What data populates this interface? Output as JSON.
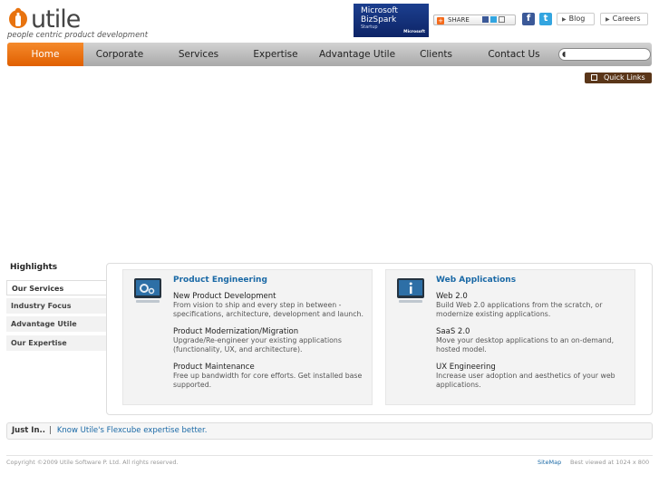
{
  "header": {
    "logo_text": "utile",
    "tagline": "people centric product development",
    "bizspark": {
      "line1": "Microsoft",
      "line2": "BizSpark",
      "line3": "Startup",
      "brand": "Microsoft"
    },
    "share_label": "SHARE",
    "blog_label": "Blog",
    "careers_label": "Careers"
  },
  "nav": {
    "items": [
      "Home",
      "Corporate",
      "Services",
      "Expertise",
      "Advantage Utile",
      "Clients",
      "Contact Us"
    ],
    "active": "Home",
    "search_placeholder": ""
  },
  "quick_links_label": "Quick Links",
  "highlights": {
    "title": "Highlights",
    "tabs": [
      "Our Services",
      "Industry Focus",
      "Advantage Utile",
      "Our Expertise"
    ],
    "cards": [
      {
        "title": "Product Engineering",
        "items": [
          {
            "title": "New Product Development",
            "desc": "From vision to ship and every step in between - specifications, architecture, development and launch."
          },
          {
            "title": "Product Modernization/Migration",
            "desc": "Upgrade/Re-engineer your existing applications (functionality, UX, and architecture)."
          },
          {
            "title": "Product Maintenance",
            "desc": "Free up bandwidth for core efforts. Get installed base supported."
          }
        ]
      },
      {
        "title": "Web Applications",
        "items": [
          {
            "title": "Web 2.0",
            "desc": "Build Web 2.0 applications from the scratch, or modernize existing applications."
          },
          {
            "title": "SaaS 2.0",
            "desc": "Move your desktop applications to an on-demand, hosted model."
          },
          {
            "title": "UX Engineering",
            "desc": "Increase user adoption and aesthetics of your web applications."
          }
        ]
      }
    ]
  },
  "just_in": {
    "label": "Just In..",
    "separator": "|",
    "link": "Know Utile's Flexcube expertise better."
  },
  "footer": {
    "copyright": "Copyright ©2009 Utile Software P. Ltd. All rights reserved.",
    "sitemap": "SiteMap",
    "best_viewed": "Best viewed at 1024 x 800"
  },
  "colors": {
    "accent": "#e8730f",
    "link": "#1a69a6",
    "quick_links_bg": "#5a3619"
  }
}
